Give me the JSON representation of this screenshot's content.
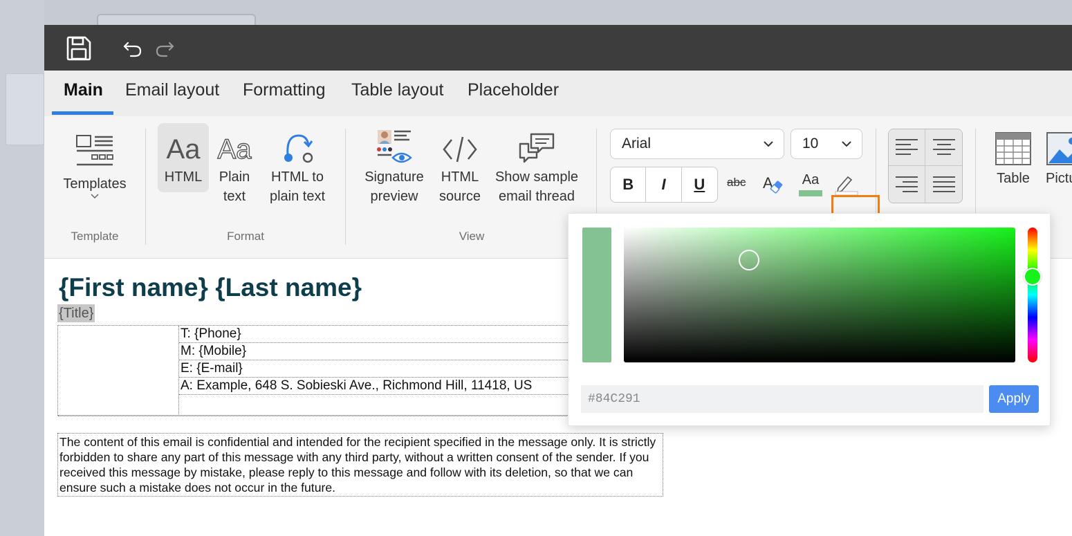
{
  "tabs": [
    {
      "label": "Main",
      "active": true
    },
    {
      "label": "Email layout",
      "active": false
    },
    {
      "label": "Formatting",
      "active": false
    },
    {
      "label": "Table layout",
      "active": false
    },
    {
      "label": "Placeholder",
      "active": false
    }
  ],
  "ribbon": {
    "template_group": {
      "label": "Template",
      "templates_button": "Templates"
    },
    "format_group": {
      "label": "Format",
      "html_button": "HTML",
      "plain_text_line1": "Plain",
      "plain_text_line2": "text",
      "html_to_plain_line1": "HTML to",
      "html_to_plain_line2": "plain text",
      "html_icon_text": "Aa",
      "plain_icon_text": "Aa"
    },
    "view_group": {
      "label": "View",
      "signature_line1": "Signature",
      "signature_line2": "preview",
      "html_source_line1": "HTML",
      "html_source_line2": "source",
      "sample_line1": "Show sample",
      "sample_line2": "email thread"
    },
    "font": {
      "family": "Arial",
      "size": "10"
    },
    "formatting": {
      "bold": "B",
      "italic": "I",
      "underline": "U",
      "strike": "abc",
      "font_color_label": "Aa",
      "font_color": "#84C291"
    },
    "insert": {
      "table_label": "Table",
      "picture_label": "Pictu"
    }
  },
  "document": {
    "name": "{First name} {Last name}",
    "title": "{Title}",
    "phone": "T: {Phone}",
    "mobile": "M: {Mobile}",
    "email": "E: {E-mail}",
    "address": "A: Example, 648 S. Sobieski Ave., Richmond Hill, 11418, US",
    "disclaimer": "The content of this email is confidential and intended for the recipient specified in the message only. It is strictly forbidden to share any part of this message with any third party, without a written consent of the sender. If you received this message by mistake, please reply to this message and follow with its deletion, so that we can ensure such a mistake does not occur in the future."
  },
  "color_picker": {
    "hex_value": "#84C291",
    "apply_label": "Apply",
    "current_color": "#84C291",
    "hue_color": "#17F21B"
  },
  "colors": {
    "titlebar": "#3d3d3d",
    "accent": "#2f7fe0",
    "name_color": "#0e3d4c",
    "highlight": "#f27d13",
    "apply_button": "#4c8cf0"
  }
}
